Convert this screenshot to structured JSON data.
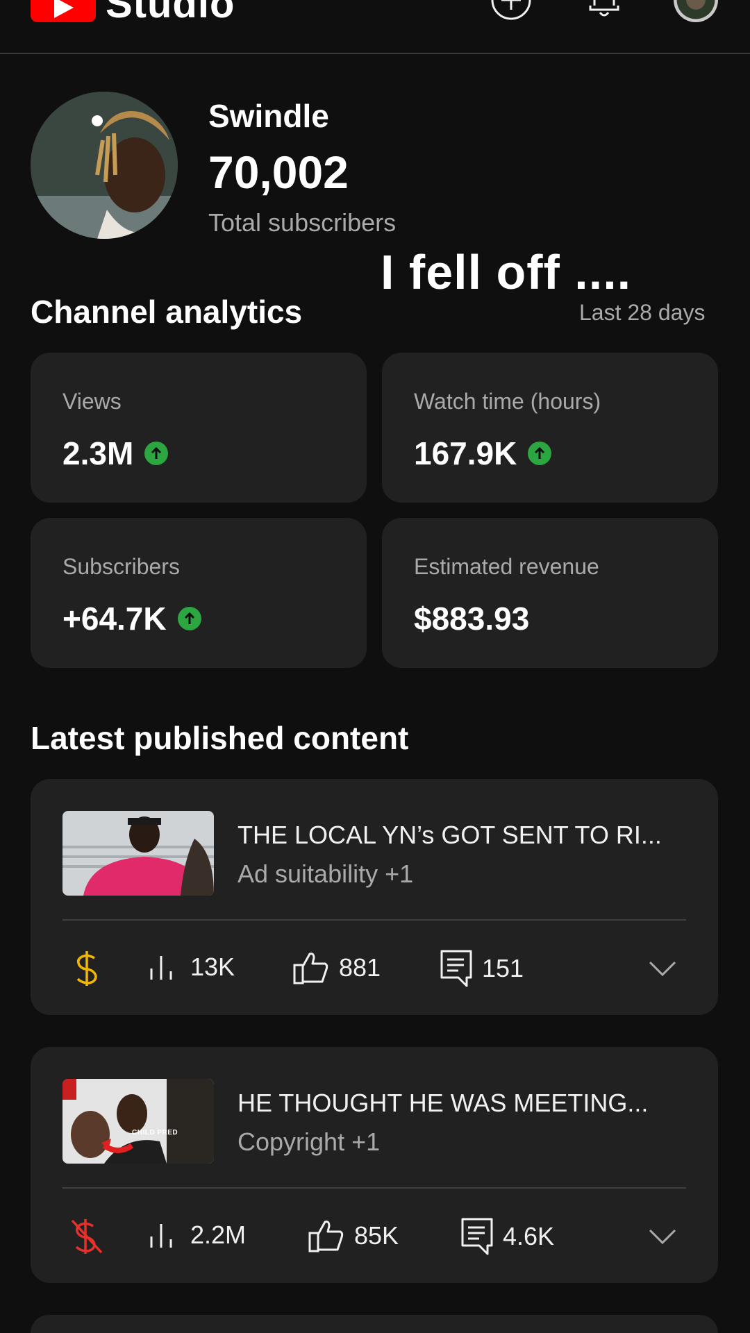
{
  "header": {
    "logo_text": "Studio",
    "icons": [
      "create-icon",
      "notifications-icon",
      "account-avatar"
    ]
  },
  "channel": {
    "name": "Swindle",
    "subscriber_count": "70,002",
    "subscriber_label": "Total subscribers",
    "overlay_caption": "I fell off ...."
  },
  "analytics": {
    "title": "Channel analytics",
    "period": "Last 28 days",
    "metrics": [
      {
        "label": "Views",
        "value": "2.3M",
        "trend": "up"
      },
      {
        "label": "Watch time (hours)",
        "value": "167.9K",
        "trend": "up"
      },
      {
        "label": "Subscribers",
        "value": "+64.7K",
        "trend": "up"
      },
      {
        "label": "Estimated revenue",
        "value": "$883.93",
        "trend": "none"
      }
    ]
  },
  "latest": {
    "title": "Latest published content",
    "videos": [
      {
        "title": "THE LOCAL YN’s GOT SENT TO RI...",
        "subtitle": "Ad suitability +1",
        "monetization": "monetized",
        "views": "13K",
        "likes": "881",
        "comments": "151"
      },
      {
        "title": "HE THOUGHT HE WAS MEETING...",
        "subtitle": "Copyright +1",
        "thumb_caption": "CHILD PRED",
        "monetization": "not-monetized",
        "views": "2.2M",
        "likes": "85K",
        "comments": "4.6K"
      }
    ]
  },
  "colors": {
    "background": "#0f0f0f",
    "card": "#212121",
    "brand_red": "#ff0000",
    "trend_up": "#2ba640",
    "monetized_yellow": "#f2b705",
    "demonetized_red": "#e5312b",
    "secondary_text": "#aaaaaa"
  }
}
